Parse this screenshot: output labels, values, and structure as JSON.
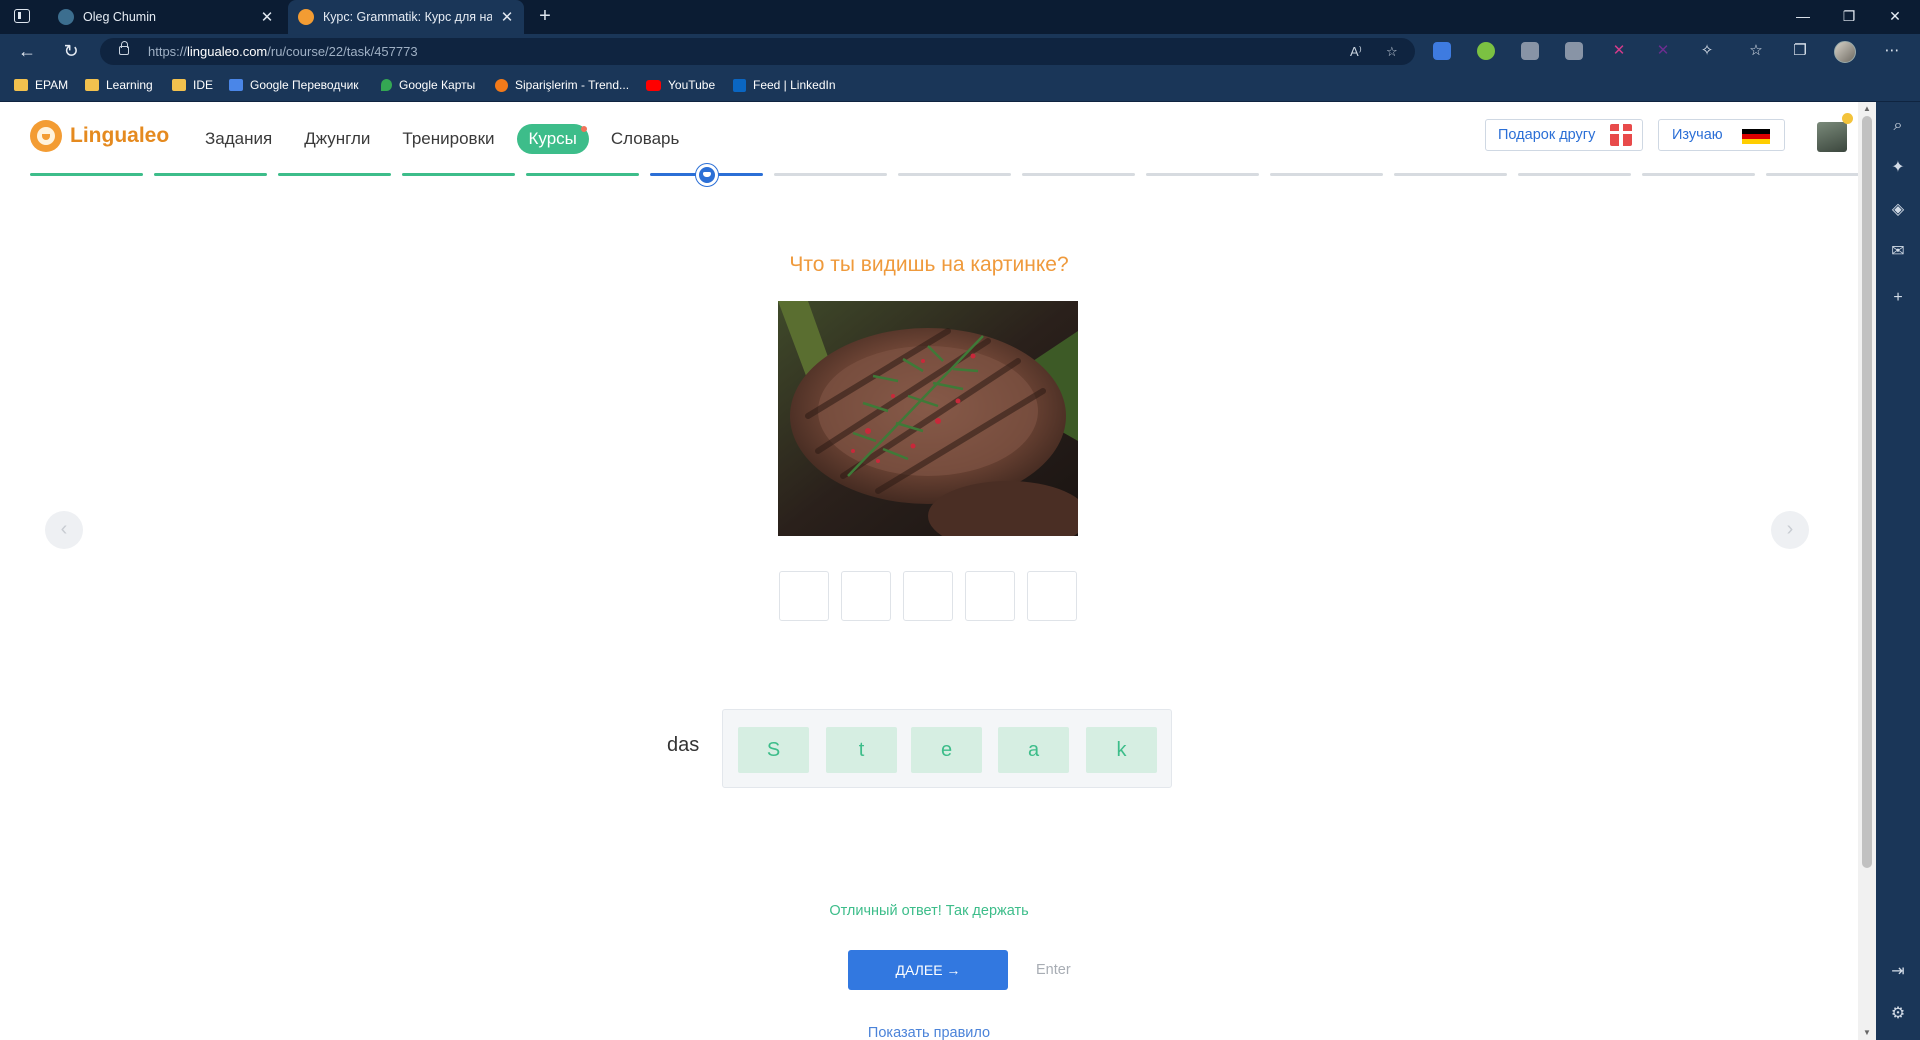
{
  "browser": {
    "tabs": [
      {
        "title": "Oleg Chumin",
        "active": false
      },
      {
        "title": "Курс: Grammatik: Курс для начи",
        "active": true
      }
    ],
    "url_prefix": "https://",
    "url_domain": "lingualeo.com",
    "url_path": "/ru/course/22/task/457773",
    "bookmarks": [
      "EPAM",
      "Learning",
      "IDE",
      "Google Переводчик",
      "Google Карты",
      "Siparişlerim - Trend...",
      "YouTube",
      "Feed | LinkedIn"
    ]
  },
  "site": {
    "logo": "Lingualeo",
    "nav": [
      "Задания",
      "Джунгли",
      "Тренировки",
      "Курсы",
      "Словарь"
    ],
    "active_nav": "Курсы",
    "gift_label": "Подарок другу",
    "learning_label": "Изучаю",
    "learning_language_flag": "de-flag-icon"
  },
  "progress": {
    "total_lessons": 15,
    "completed_lessons": 5,
    "current_lesson": 6,
    "colors": {
      "done": "#3dbd8a",
      "current": "#2b6fd6",
      "todo": "#d7dbe0"
    }
  },
  "task": {
    "question": "Что ты видишь на картинке?",
    "image_subject": "grilled steak with rosemary",
    "slot_count": 5,
    "article": "das",
    "letters": [
      "S",
      "t",
      "e",
      "a",
      "k"
    ],
    "feedback": "Отличный ответ! Так держать",
    "next_label": "ДАЛЕЕ →",
    "enter_hint": "Enter",
    "rule_link": "Показать правило"
  },
  "colors": {
    "accent_green": "#3dbd8a",
    "accent_orange": "#ef9a3c",
    "accent_blue": "#3278e0",
    "browser_dark": "#0b1c33",
    "browser_toolbar": "#1a3658"
  }
}
